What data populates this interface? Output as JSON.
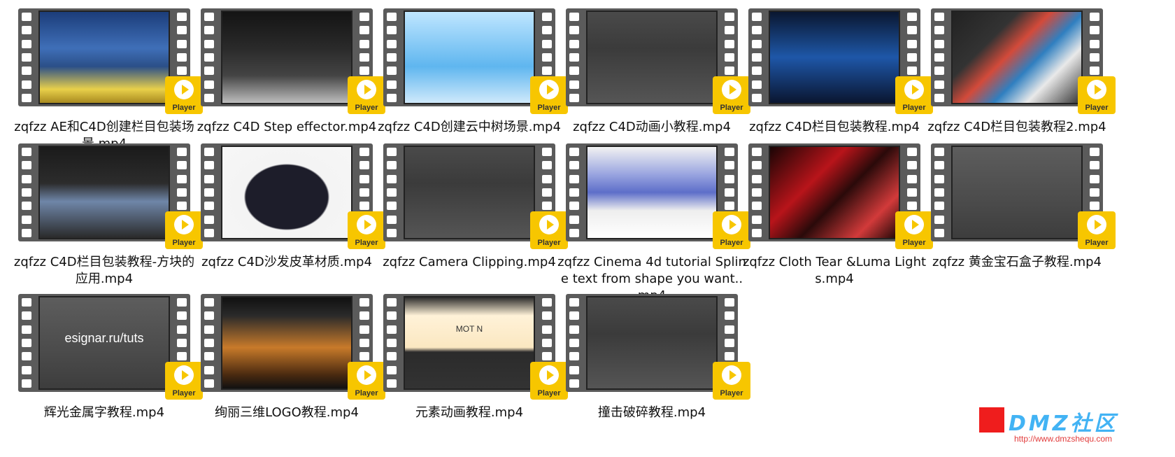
{
  "files": [
    {
      "name": "zqfzz AE和C4D创建栏目包装场景.mp4",
      "thumb": "sport"
    },
    {
      "name": "zqfzz C4D Step effector.mp4",
      "thumb": "dark"
    },
    {
      "name": "zqfzz C4D创建云中树场景.mp4",
      "thumb": "sky"
    },
    {
      "name": "zqfzz C4D动画小教程.mp4",
      "thumb": "ui"
    },
    {
      "name": "zqfzz C4D栏目包装教程.mp4",
      "thumb": "blue"
    },
    {
      "name": "zqfzz C4D栏目包装教程2.mp4",
      "thumb": "ribbon"
    },
    {
      "name": "zqfzz C4D栏目包装教程-方块的应用.mp4",
      "thumb": "web"
    },
    {
      "name": "zqfzz C4D沙发皮革材质.mp4",
      "thumb": "sofa"
    },
    {
      "name": "zqfzz Camera Clipping.mp4",
      "thumb": "ui"
    },
    {
      "name": "zqfzz Cinema 4d tutorial Spline text from shape you want..mp4",
      "thumb": "vimeo"
    },
    {
      "name": "zqfzz Cloth Tear  &Luma Lights.mp4",
      "thumb": "red"
    },
    {
      "name": "zqfzz 黄金宝石盒子教程.mp4",
      "thumb": "gray"
    },
    {
      "name": "辉光金属字教程.mp4",
      "thumb": "gray",
      "caption": "esignar.ru/tuts"
    },
    {
      "name": "绚丽三维LOGO教程.mp4",
      "thumb": "city"
    },
    {
      "name": "元素动画教程.mp4",
      "thumb": "motion",
      "caption": "MOT N"
    },
    {
      "name": "撞击破碎教程.mp4",
      "thumb": "ui"
    }
  ],
  "player_label": "Player",
  "watermark": {
    "title": "DMZ社区",
    "url": "http://www.dmzshequ.com"
  }
}
